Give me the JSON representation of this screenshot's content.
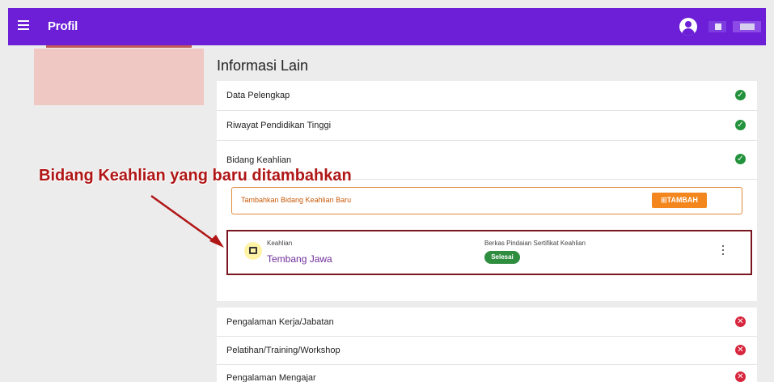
{
  "header": {
    "title": "Profil"
  },
  "section_title": "Informasi Lain",
  "rows_top": [
    {
      "label": "Data Pelengkap",
      "status": "complete"
    },
    {
      "label": "Riwayat Pendidikan Tinggi",
      "status": "complete"
    },
    {
      "label": "Bidang Keahlian",
      "status": "complete"
    }
  ],
  "add_skill": {
    "label": "Tambahkan Bidang Keahlian Baru",
    "button": "TAMBAH"
  },
  "skill_entry": {
    "field_label": "Keahlian",
    "field_value": "Tembang Jawa",
    "file_label": "Berkas Pindaian Sertifikat Keahlian",
    "file_status": "Selesai"
  },
  "rows_bottom": [
    {
      "label": "Pengalaman Kerja/Jabatan",
      "status": "incomplete"
    },
    {
      "label": "Pelatihan/Training/Workshop",
      "status": "incomplete"
    },
    {
      "label": "Pengalaman Mengajar",
      "status": "incomplete"
    }
  ],
  "annotation": {
    "text": "Bidang Keahlian yang baru ditambahkan"
  },
  "icons": {
    "menu": "hamburger-menu-icon",
    "account": "account-circle-icon",
    "ok": "check-circle-icon",
    "no": "cancel-circle-icon",
    "add": "add-box-icon",
    "skill": "certificate-icon",
    "more": "more-vertical-icon"
  },
  "colors": {
    "appbar": "#6c1fd6",
    "ok": "#23923c",
    "no": "#d7263d",
    "add_button": "#f3861c",
    "skill_text": "#6f2d9a",
    "annotation": "#b01616"
  }
}
